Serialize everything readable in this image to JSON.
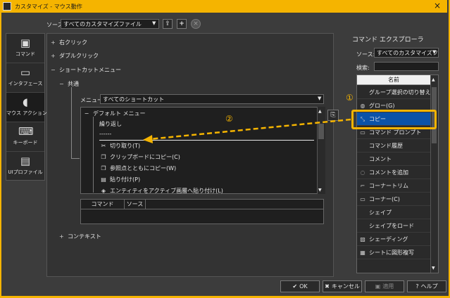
{
  "window": {
    "title": "カスタマイズ - マウス動作",
    "close_glyph": "×"
  },
  "toolbar": {
    "source_label": "ソース:",
    "source_value": "すべてのカスタマイズファイル"
  },
  "categories": [
    {
      "label": "コマンド",
      "icon": "command-icon"
    },
    {
      "label": "インタフェース",
      "icon": "monitor-icon"
    },
    {
      "label": "マウス アクション",
      "icon": "mouse-icon"
    },
    {
      "label": "キーボード",
      "icon": "keyboard-icon"
    },
    {
      "label": "UIプロファイル",
      "icon": "ui-profile-icon"
    }
  ],
  "tree": {
    "right_click": "右クリック",
    "double_click": "ダブルクリック",
    "shortcut_menu": "ショートカットメニュー",
    "common": "共通",
    "context": "コンテキスト",
    "menu_label": "メニュー:",
    "menu_value": "すべてのショートカット",
    "default_menu": "デフォルト メニュー",
    "items": [
      {
        "label": "繰り返し",
        "icon": ""
      },
      {
        "label": "------",
        "icon": ""
      },
      {
        "label": "切り取り(T)",
        "icon": "scissors-icon"
      },
      {
        "label": "クリップボードにコピー(C)",
        "icon": "copy-icon"
      },
      {
        "label": "参照点とともにコピー(W)",
        "icon": "copy-base-icon"
      },
      {
        "label": "貼り付け(P)",
        "icon": "paste-icon"
      },
      {
        "label": "エンティティをアクティブ画層へ貼り付け(L)",
        "icon": "paste-layer-icon"
      }
    ]
  },
  "command_table": {
    "col_command": "コマンド",
    "col_source": "ソース"
  },
  "explorer": {
    "title": "コマンド エクスプローラ",
    "source_label": "ソース:",
    "source_value": "すべてのカスタマイズファイル",
    "search_label": "検索:",
    "search_value": "",
    "header_name": "名前",
    "commands": [
      {
        "label": "グループ選択の切り替え",
        "icon": ""
      },
      {
        "label": "グロー(G)",
        "icon": "glow-icon"
      },
      {
        "label": "コピー",
        "icon": "copy-icon"
      },
      {
        "label": "コマンド プロンプト",
        "icon": "prompt-icon"
      },
      {
        "label": "コマンド履歴",
        "icon": ""
      },
      {
        "label": "コメント",
        "icon": ""
      },
      {
        "label": "コメントを追加",
        "icon": "comment-add-icon"
      },
      {
        "label": "コーナートリム",
        "icon": "corner-trim-icon"
      },
      {
        "label": "コーナー(C)",
        "icon": "corner-icon"
      },
      {
        "label": "シェイプ",
        "icon": ""
      },
      {
        "label": "シェイプをロード",
        "icon": ""
      },
      {
        "label": "シェーディング",
        "icon": "shading-icon"
      },
      {
        "label": "シートに図形複写",
        "icon": "sheet-copy-icon"
      }
    ],
    "selected_index": 2
  },
  "annotations": {
    "marker_1": "①",
    "marker_2": "②",
    "highlight_color": "#f5b400",
    "arrow_color": "#f5b400"
  },
  "buttons": {
    "ok": "OK",
    "cancel": "キャンセル",
    "apply": "適用",
    "help": "ヘルプ"
  },
  "colors": {
    "accent": "#f5b400",
    "selection": "#0a52a8",
    "panel": "#333333"
  }
}
